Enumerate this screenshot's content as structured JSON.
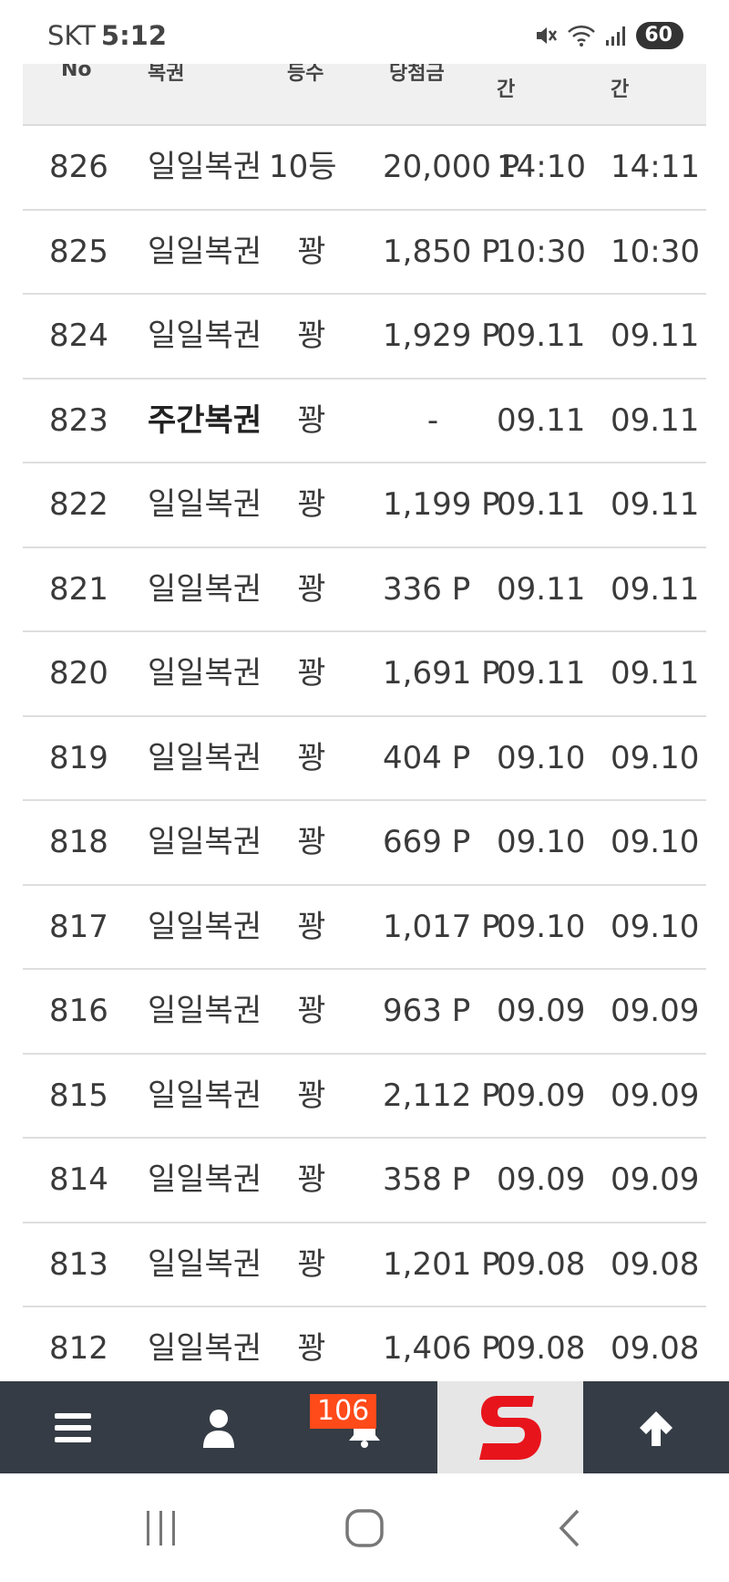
{
  "status_bar": {
    "carrier": "SKT",
    "time": "5:12",
    "battery": "60",
    "icons": [
      "mute-icon",
      "wifi-icon",
      "signal-icon"
    ]
  },
  "table": {
    "headers": [
      "No",
      "복권",
      "등수",
      "당첨금",
      "간",
      "간"
    ],
    "rows": [
      {
        "no": "826",
        "type": "일일복권",
        "rank": "10등",
        "amount": "20,000 P",
        "t1": "14:10",
        "t2": "14:11"
      },
      {
        "no": "825",
        "type": "일일복권",
        "rank": "꽝",
        "amount": "1,850 P",
        "t1": "10:30",
        "t2": "10:30"
      },
      {
        "no": "824",
        "type": "일일복권",
        "rank": "꽝",
        "amount": "1,929 P",
        "t1": "09.11",
        "t2": "09.11"
      },
      {
        "no": "823",
        "type": "주간복권",
        "rank": "꽝",
        "amount": "-",
        "t1": "09.11",
        "t2": "09.11"
      },
      {
        "no": "822",
        "type": "일일복권",
        "rank": "꽝",
        "amount": "1,199 P",
        "t1": "09.11",
        "t2": "09.11"
      },
      {
        "no": "821",
        "type": "일일복권",
        "rank": "꽝",
        "amount": "336 P",
        "t1": "09.11",
        "t2": "09.11"
      },
      {
        "no": "820",
        "type": "일일복권",
        "rank": "꽝",
        "amount": "1,691 P",
        "t1": "09.11",
        "t2": "09.11"
      },
      {
        "no": "819",
        "type": "일일복권",
        "rank": "꽝",
        "amount": "404 P",
        "t1": "09.10",
        "t2": "09.10"
      },
      {
        "no": "818",
        "type": "일일복권",
        "rank": "꽝",
        "amount": "669 P",
        "t1": "09.10",
        "t2": "09.10"
      },
      {
        "no": "817",
        "type": "일일복권",
        "rank": "꽝",
        "amount": "1,017 P",
        "t1": "09.10",
        "t2": "09.10"
      },
      {
        "no": "816",
        "type": "일일복권",
        "rank": "꽝",
        "amount": "963 P",
        "t1": "09.09",
        "t2": "09.09"
      },
      {
        "no": "815",
        "type": "일일복권",
        "rank": "꽝",
        "amount": "2,112 P",
        "t1": "09.09",
        "t2": "09.09"
      },
      {
        "no": "814",
        "type": "일일복권",
        "rank": "꽝",
        "amount": "358 P",
        "t1": "09.09",
        "t2": "09.09"
      },
      {
        "no": "813",
        "type": "일일복권",
        "rank": "꽝",
        "amount": "1,201 P",
        "t1": "09.08",
        "t2": "09.08"
      },
      {
        "no": "812",
        "type": "일일복권",
        "rank": "꽝",
        "amount": "1,406 P",
        "t1": "09.08",
        "t2": "09.08"
      }
    ]
  },
  "bottom_nav": {
    "items": [
      "menu-icon",
      "user-icon",
      "bell-icon",
      "site-logo",
      "arrow-up-icon"
    ],
    "notification_count": "106",
    "colors": {
      "background": "#353c45",
      "badge": "#ff4a1a",
      "logo_red": "#e8141c"
    }
  },
  "system_nav": {
    "items": [
      "recent-apps-icon",
      "home-icon",
      "back-icon"
    ]
  }
}
